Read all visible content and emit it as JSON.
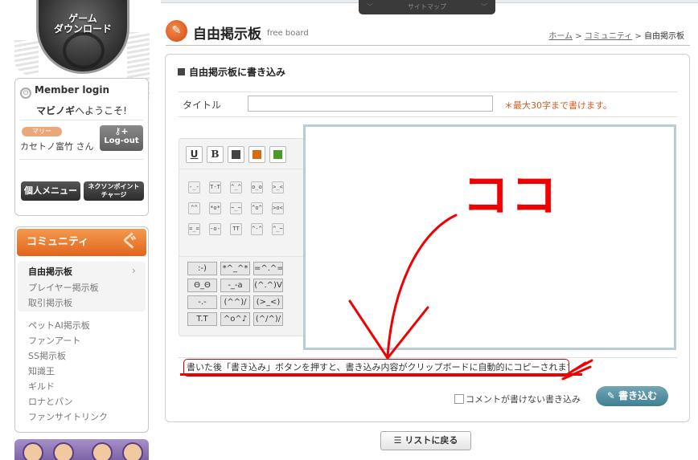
{
  "top_nav": {
    "sitemap_label": "サイトマップ"
  },
  "sidebar": {
    "game_download": "ゲーム\nダウンロード",
    "login": {
      "title": "Member login",
      "welcome_brand": "マビノギ",
      "welcome_rest": "へようこそ!",
      "badge": "マリー",
      "user_name": "カセトノ富竹 さん",
      "logout_label": "Log-out",
      "personal_menu": "個人メニュー",
      "nexon_charge": "ネクソンポイント\nチャージ"
    },
    "community": {
      "header": "コミュニティ",
      "items": [
        {
          "label": "自由掲示板",
          "active": true
        },
        {
          "label": "プレイヤー掲示板"
        },
        {
          "label": "取引掲示板"
        },
        {
          "label": "ペットAI掲示板"
        },
        {
          "label": "ファンアート"
        },
        {
          "label": "SS掲示板"
        },
        {
          "label": "知識王"
        },
        {
          "label": "ギルド"
        },
        {
          "label": "ロナとパン"
        },
        {
          "label": "ファンサイトリンク"
        }
      ]
    }
  },
  "header": {
    "title": "自由掲示板",
    "subtitle": "free board",
    "breadcrumb": {
      "home": "ホーム",
      "community": "コミュニティ",
      "current": "自由掲示板"
    }
  },
  "form": {
    "heading": "自由掲示板に書き込み",
    "title_label": "タイトル",
    "title_value": "",
    "title_note": "＊最大30字まで書けます。",
    "format_buttons": [
      {
        "kind": "underline",
        "label": "U"
      },
      {
        "kind": "bold",
        "label": "B"
      },
      {
        "kind": "color",
        "color": "#444444"
      },
      {
        "kind": "color",
        "color": "#d86a12"
      },
      {
        "kind": "color",
        "color": "#4c9a2a"
      }
    ],
    "emoticons": [
      "-_-",
      "T-T",
      "^_^",
      "o_o",
      ">_<",
      "^^",
      "*o*",
      "~_~",
      "^o^",
      ">o<",
      "=_=",
      "-o-",
      "TT",
      "^-^",
      "^_~"
    ],
    "kaomoji": [
      ":-)",
      "*^_^*",
      "=^.^=",
      "Θ_Θ",
      "-_-a",
      "(^.^)V",
      "-.-",
      "(^^)/",
      "(>_<)",
      "T.T",
      "^o^♪",
      "(^/^)/"
    ],
    "editor_annotation": "ココ",
    "notice": "書いた後「書き込み」ボタンを押すと、書き込み内容がクリップボードに自動的にコピーされます。",
    "no_comment_label": "コメントが書けない書き込み",
    "submit_label": "書き込む",
    "back_label": "リストに戻る"
  }
}
